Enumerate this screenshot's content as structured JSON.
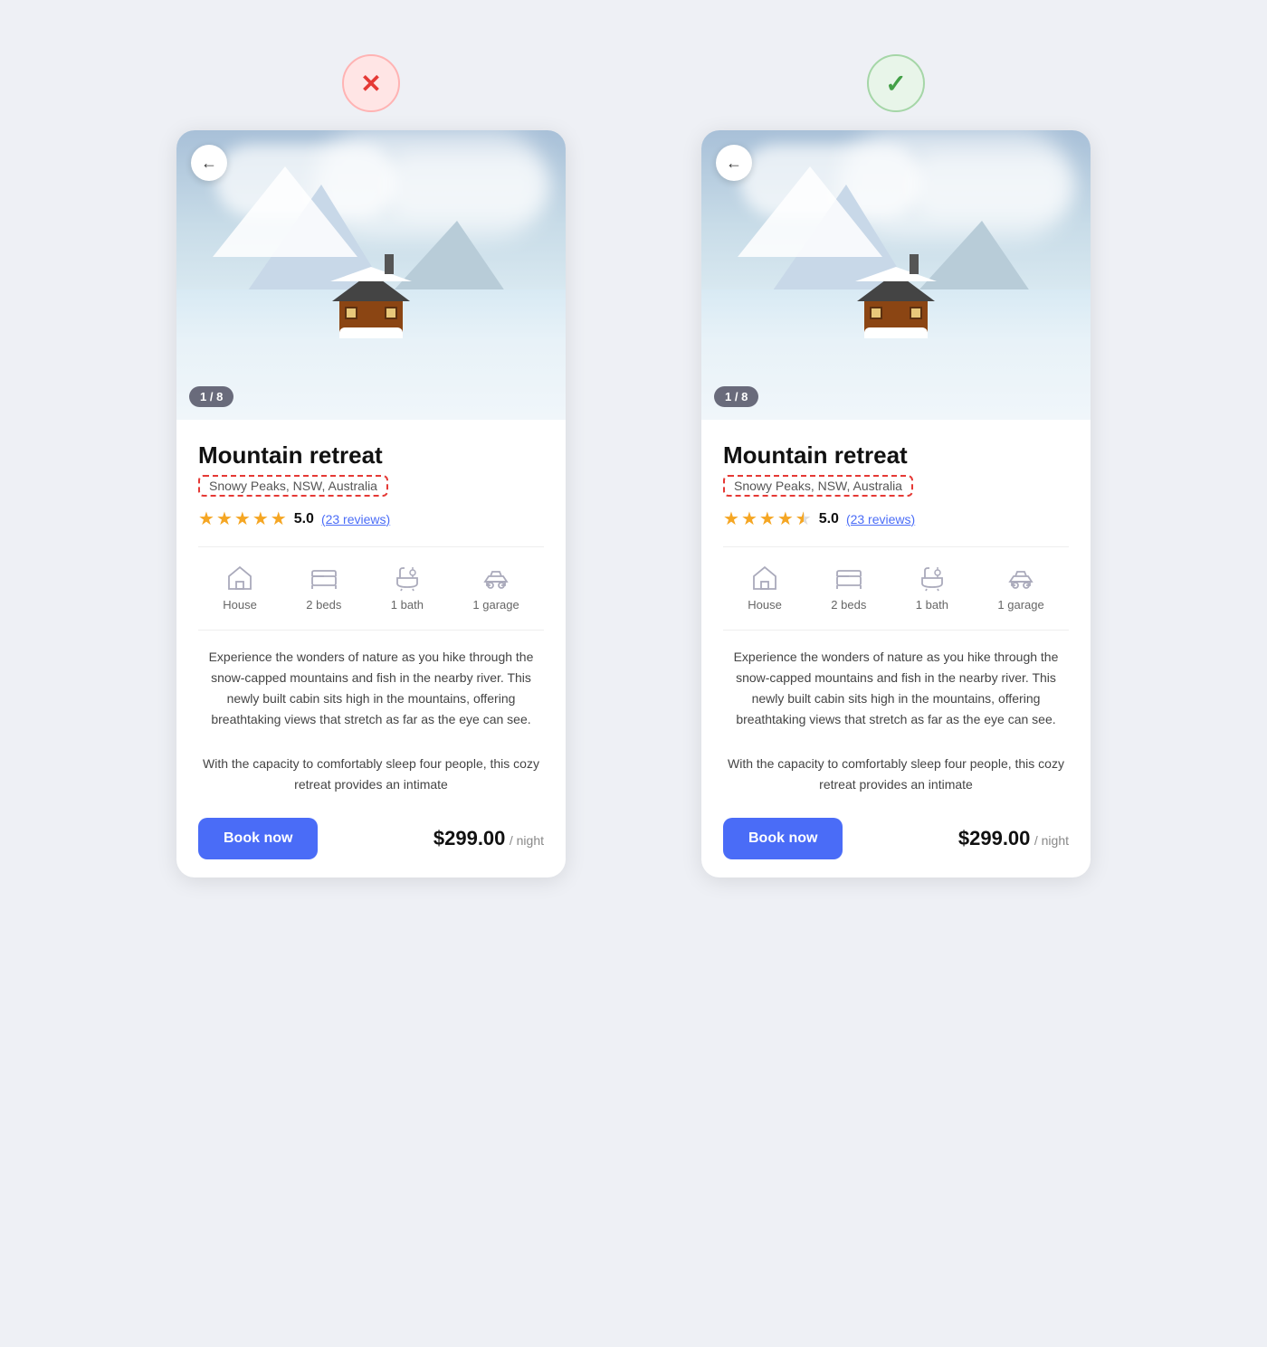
{
  "page": {
    "background_color": "#eef0f5"
  },
  "left_card": {
    "indicator": {
      "type": "wrong",
      "symbol": "✕",
      "label": "wrong-indicator"
    },
    "back_button_label": "←",
    "image_counter": "1 / 8",
    "title": "Mountain retreat",
    "location": "Snowy Peaks, NSW, Australia",
    "rating_score": "5.0",
    "rating_reviews": "(23 reviews)",
    "stars": [
      {
        "type": "full"
      },
      {
        "type": "full"
      },
      {
        "type": "full"
      },
      {
        "type": "full"
      },
      {
        "type": "full"
      }
    ],
    "amenities": [
      {
        "icon": "house",
        "label": "House"
      },
      {
        "icon": "bed",
        "label": "2 beds"
      },
      {
        "icon": "bath",
        "label": "1 bath"
      },
      {
        "icon": "car",
        "label": "1 garage"
      }
    ],
    "description_1": "Experience the wonders of nature as you hike through the snow-capped mountains and fish in the nearby river. This newly built cabin sits high in the mountains, offering breathtaking views that stretch as far as the eye can see.",
    "description_2": "With the capacity to comfortably sleep four people, this cozy retreat provides an intimate",
    "book_button": "Book now",
    "price": "$299.00",
    "price_suffix": "/ night"
  },
  "right_card": {
    "indicator": {
      "type": "correct",
      "symbol": "✓",
      "label": "correct-indicator"
    },
    "back_button_label": "←",
    "image_counter": "1 / 8",
    "title": "Mountain retreat",
    "location": "Snowy Peaks, NSW, Australia",
    "rating_score": "5.0",
    "rating_reviews": "(23 reviews)",
    "stars": [
      {
        "type": "full"
      },
      {
        "type": "full"
      },
      {
        "type": "full"
      },
      {
        "type": "full"
      },
      {
        "type": "half"
      }
    ],
    "amenities": [
      {
        "icon": "house",
        "label": "House"
      },
      {
        "icon": "bed",
        "label": "2 beds"
      },
      {
        "icon": "bath",
        "label": "1 bath"
      },
      {
        "icon": "car",
        "label": "1 garage"
      }
    ],
    "description_1": "Experience the wonders of nature as you hike through the snow-capped mountains and fish in the nearby river. This newly built cabin sits high in the mountains, offering breathtaking views that stretch as far as the eye can see.",
    "description_2": "With the capacity to comfortably sleep four people, this cozy retreat provides an intimate",
    "book_button": "Book now",
    "price": "$299.00",
    "price_suffix": "/ night"
  }
}
